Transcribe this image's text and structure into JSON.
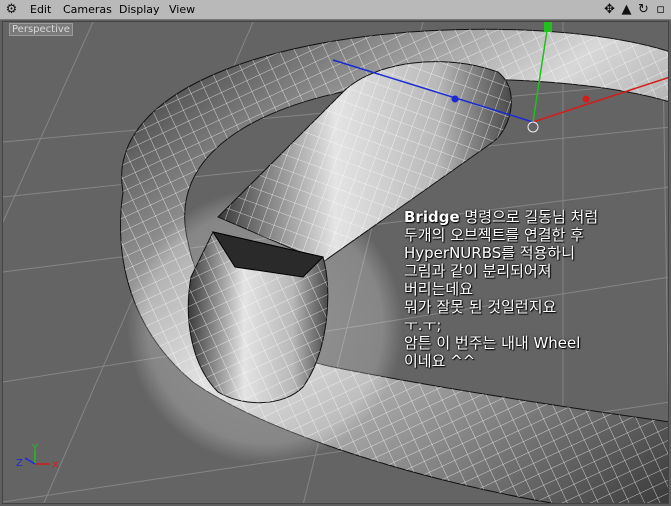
{
  "menu": {
    "edit": "Edit",
    "cameras": "Cameras",
    "display": "Display",
    "view": "View"
  },
  "toolbar_icons": [
    "app-logo-icon",
    "move-icon",
    "zoom-icon",
    "rotate-icon",
    "maximize-icon"
  ],
  "viewport": {
    "label": "Perspective"
  },
  "axes": {
    "x": "X",
    "y": "Y",
    "z": "Z"
  },
  "note": {
    "line1_bold": "Bridge",
    "line1_rest": " 명령으로 길동님 처럼",
    "line2": "두개의 오브젝트를 연결한 후",
    "line3": "HyperNURBS를 적용하니",
    "line4": "그림과 같이 분리되어져",
    "line5": "버리는데요",
    "line6": "뭐가 잘못 된 것일런지요",
    "line7": "ㅜ.ㅜ;",
    "line8": "암튼 이 번주는 내내 Wheel",
    "line9": "이네요 ^^"
  },
  "colors": {
    "menubar": "#b9b9b9",
    "viewport_bg": "#646464",
    "grid": "#858585",
    "axis_x": "#d41c1c",
    "axis_y": "#22c01c",
    "axis_z": "#1c2ad4"
  }
}
